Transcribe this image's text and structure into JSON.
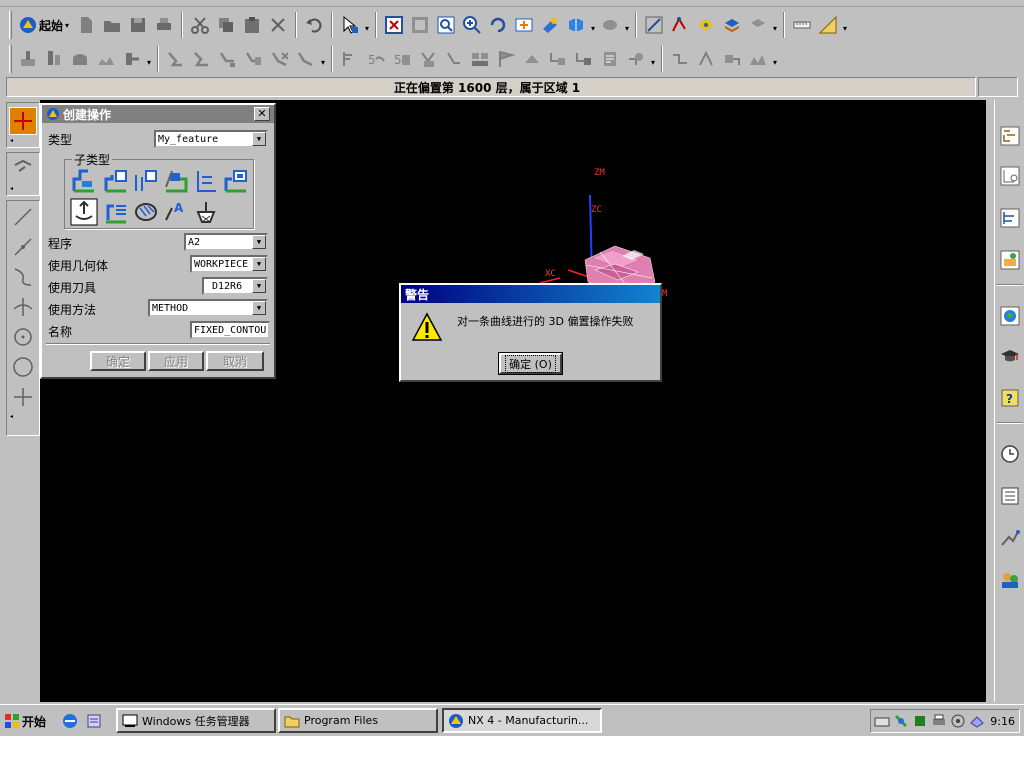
{
  "toolbar": {
    "start_label": "起始",
    "icons_row1": [
      "new-icon",
      "open-icon",
      "save-icon",
      "print-icon",
      "cut-icon",
      "copy-icon",
      "paste-icon",
      "delete-icon",
      "undo-icon",
      "select-icon",
      "fit-icon",
      "zoom-window-icon",
      "zoom-icon",
      "rotate-icon",
      "pan-icon",
      "shaded-icon",
      "view-cube-icon",
      "render-icon",
      "line-icon",
      "snap-icon",
      "filter-icon",
      "layer-icon",
      "measure-icon",
      "ruler-icon"
    ],
    "icons_row2": [
      "mill-icon",
      "drill-icon",
      "turn-icon",
      "wire-icon",
      "program-icon",
      "generate-icon",
      "replay-icon",
      "list-icon",
      "verify-icon",
      "postprocess-icon",
      "output-icon",
      "shop-doc-icon",
      "settings-icon",
      "tool-icon",
      "geometry-icon",
      "method-icon",
      "object-icon",
      "feature-icon"
    ]
  },
  "status": {
    "text": "正在偏置第 1600 层，属于区域 1"
  },
  "create_operation": {
    "title": "创建操作",
    "type_label": "类型",
    "type_value": "My_feature",
    "subtype_label": "子类型",
    "program_label": "程序",
    "program_value": "A2",
    "geometry_label": "使用几何体",
    "geometry_value": "WORKPIECE",
    "tool_label": "使用刀具",
    "tool_value": "D12R6",
    "method_label": "使用方法",
    "method_value": "METHOD",
    "name_label": "名称",
    "name_value": "FIXED_CONTOU",
    "ok_label": "确定",
    "apply_label": "应用",
    "cancel_label": "取消"
  },
  "viewport": {
    "axis_zm": "ZM",
    "axis_zc": "ZC",
    "axis_xc": "XC",
    "axis_m": "M"
  },
  "warning": {
    "title": "警告",
    "message": "对一条曲线进行的 3D 偏置操作失败",
    "ok_label": "确定 (O)"
  },
  "taskbar": {
    "start_label": "开始",
    "tasks": [
      {
        "label": "Windows 任务管理器"
      },
      {
        "label": "Program Files"
      },
      {
        "label": "NX 4 - Manufacturin..."
      }
    ],
    "clock": "9:16"
  }
}
